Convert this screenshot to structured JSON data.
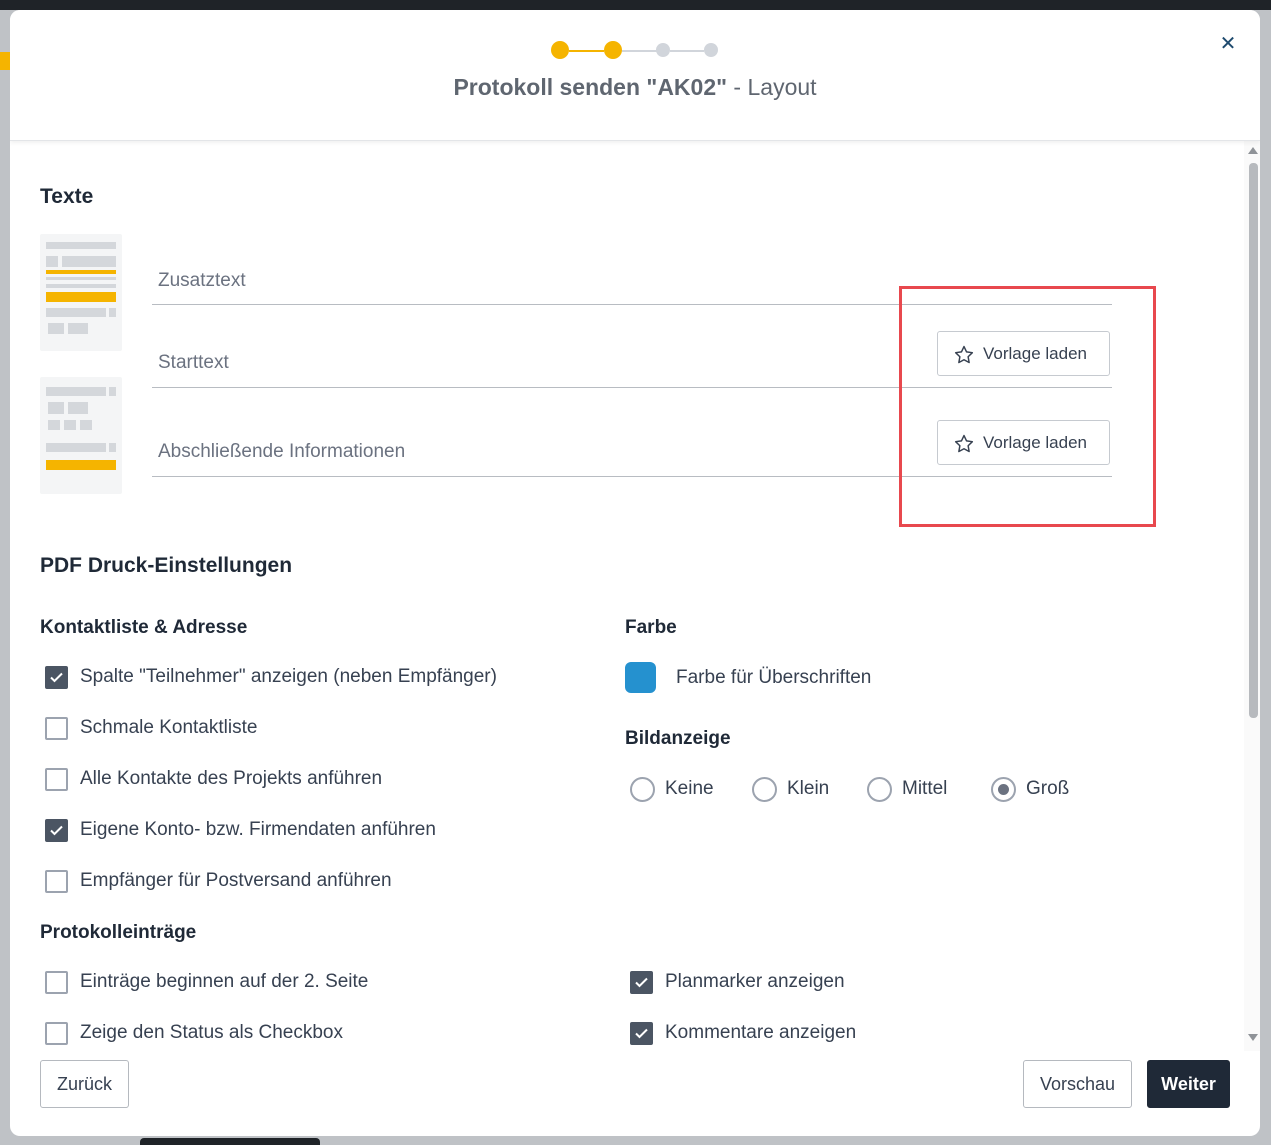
{
  "dialog": {
    "title_bold": "Protokoll senden \"AK02\"",
    "title_separator": " - ",
    "title_rest": "Layout",
    "close_icon": "✕",
    "steps": [
      {
        "state": "done"
      },
      {
        "state": "active"
      },
      {
        "state": "pending"
      },
      {
        "state": "pending"
      }
    ]
  },
  "texts_section": {
    "title": "Texte",
    "fields": [
      {
        "label": "Zusatztext",
        "has_template_button": false
      },
      {
        "label": "Starttext",
        "has_template_button": true
      },
      {
        "label": "Abschließende Informationen",
        "has_template_button": true
      }
    ],
    "template_button_label": "Vorlage laden",
    "template_button_icon": "star-outline-icon"
  },
  "pdf_section": {
    "title": "PDF Druck-Einstellungen",
    "contact": {
      "title": "Kontaktliste & Adresse",
      "options": [
        {
          "label": "Spalte \"Teilnehmer\" anzeigen (neben Empfänger)",
          "checked": true
        },
        {
          "label": "Schmale Kontaktliste",
          "checked": false
        },
        {
          "label": "Alle Kontakte des Projekts anführen",
          "checked": false
        },
        {
          "label": "Eigene Konto- bzw. Firmendaten anführen",
          "checked": true
        },
        {
          "label": "Empfänger für Postversand anführen",
          "checked": false
        }
      ]
    },
    "color": {
      "title": "Farbe",
      "label": "Farbe für Überschriften",
      "value": "#2591cf"
    },
    "image_display": {
      "title": "Bildanzeige",
      "options": [
        "Keine",
        "Klein",
        "Mittel",
        "Groß"
      ],
      "selected": "Groß"
    },
    "entries": {
      "title": "Protokolleinträge",
      "left_options": [
        {
          "label": "Einträge beginnen auf der 2. Seite",
          "checked": false
        },
        {
          "label": "Zeige den Status als Checkbox",
          "checked": false
        }
      ],
      "right_options": [
        {
          "label": "Planmarker anzeigen",
          "checked": true
        },
        {
          "label": "Kommentare anzeigen",
          "checked": true
        }
      ]
    }
  },
  "footer": {
    "back": "Zurück",
    "preview": "Vorschau",
    "next": "Weiter"
  },
  "colors": {
    "accent": "#f5b400",
    "primary_dark": "#1f2937",
    "highlight": "#e8484e"
  }
}
